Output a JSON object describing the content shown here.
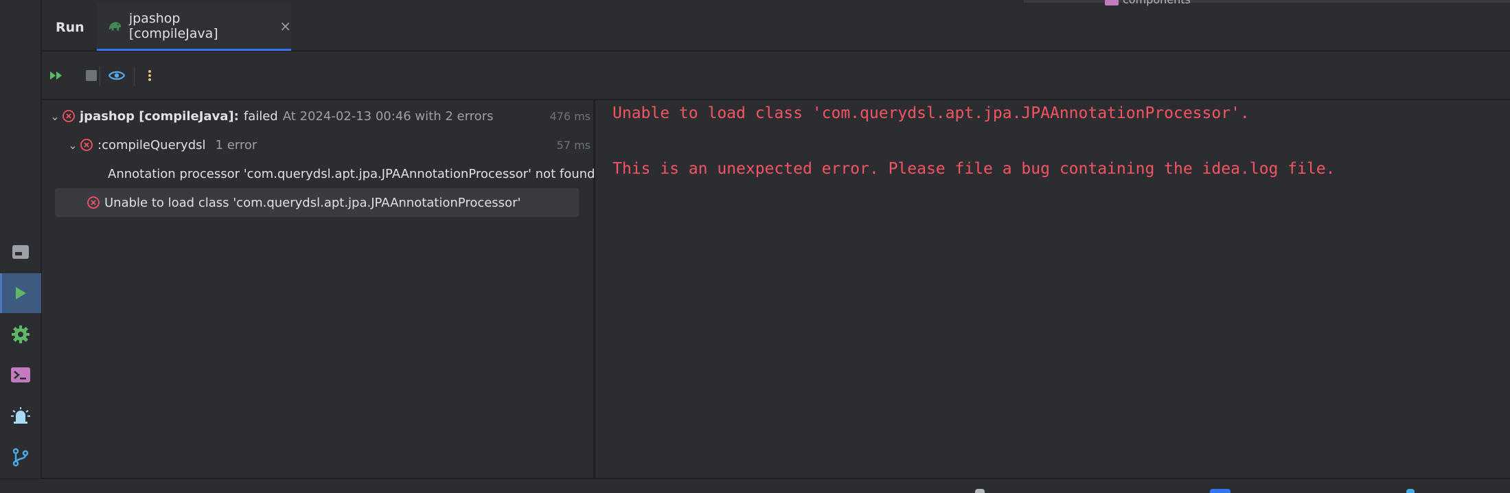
{
  "tabs": {
    "run_label": "Run",
    "active_label": "jpashop [compileJava]",
    "close_glyph": "×"
  },
  "top_fragment": "components",
  "toolbar": {
    "icons": [
      "rerun-icon",
      "stop-icon",
      "eye-icon",
      "more-icon"
    ]
  },
  "tree": {
    "root": {
      "name": "jpashop [compileJava]:",
      "status": "failed",
      "detail": "At 2024-02-13 00:46 with 2 errors",
      "time": "476 ms"
    },
    "task": {
      "name": ":compileQuerydsl",
      "detail": "1 error",
      "time": "57 ms"
    },
    "task_error": "Annotation processor 'com.querydsl.apt.jpa.JPAAnnotationProcessor' not found",
    "root_error": "Unable to load class 'com.querydsl.apt.jpa.JPAAnnotationProcessor'"
  },
  "console": {
    "line1": "Unable to load class 'com.querydsl.apt.jpa.JPAAnnotationProcessor'.",
    "line2": "This is an unexpected error. Please file a bug containing the idea.log file."
  },
  "sidebar": {
    "icons": [
      "build-icon",
      "run-icon",
      "settings-icon",
      "terminal-icon",
      "notifications-icon",
      "git-icon"
    ]
  },
  "colors": {
    "error": "#f75464",
    "accent": "#3574f0",
    "run_green": "#5fb865"
  }
}
